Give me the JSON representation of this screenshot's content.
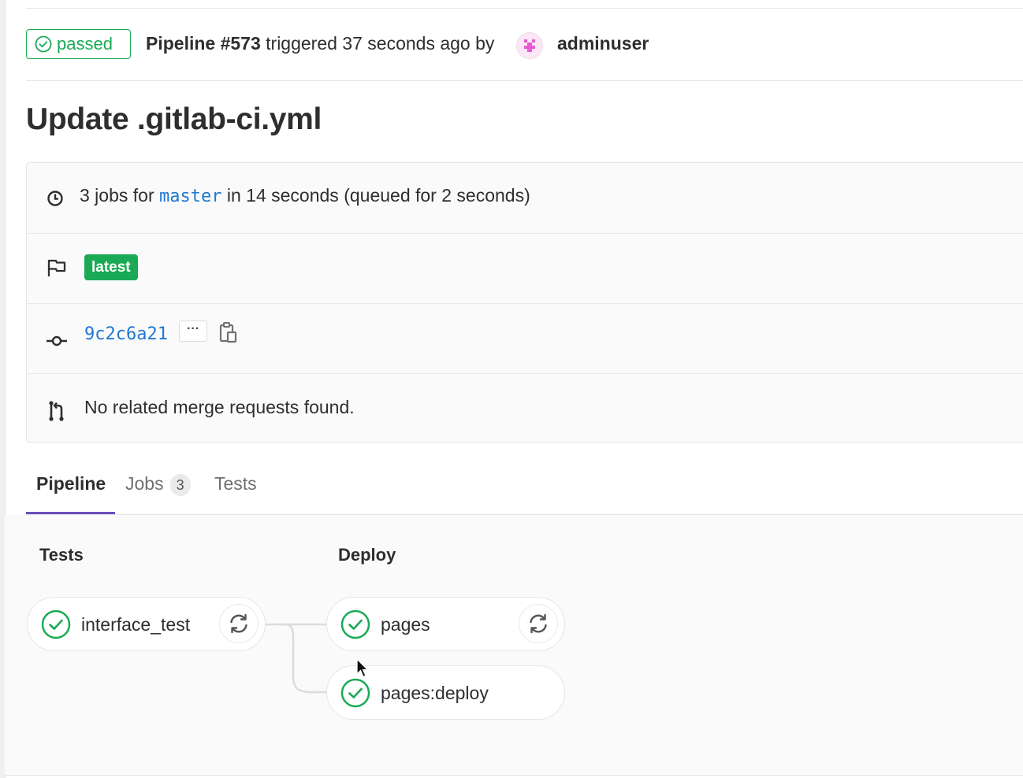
{
  "header": {
    "status": "passed",
    "pipeline_label": "Pipeline #573",
    "triggered_text": "triggered 37 seconds ago by",
    "author": "adminuser"
  },
  "commit": {
    "title": "Update .gitlab-ci.yml"
  },
  "info": {
    "jobs_prefix": "3 jobs for",
    "branch": "master",
    "jobs_suffix": "in 14 seconds (queued for 2 seconds)",
    "badge": "latest",
    "sha": "9c2c6a21",
    "ellipsis": "···",
    "merge_requests": "No related merge requests found."
  },
  "tabs": [
    {
      "label": "Pipeline"
    },
    {
      "label": "Jobs",
      "count": "3"
    },
    {
      "label": "Tests"
    }
  ],
  "stages": [
    {
      "title": "Tests",
      "jobs": [
        {
          "name": "interface_test"
        }
      ]
    },
    {
      "title": "Deploy",
      "jobs": [
        {
          "name": "pages"
        },
        {
          "name": "pages:deploy"
        }
      ]
    }
  ],
  "colors": {
    "success": "#1aaa55",
    "link": "#1f78d1",
    "tab_active": "#6b4fbb"
  },
  "icons": {
    "status": "check-circle-icon",
    "duration": "clock-icon",
    "flag": "flag-icon",
    "commit": "commit-icon",
    "copy": "clipboard-icon",
    "merge_request": "merge-request-icon",
    "retry": "retry-icon"
  }
}
